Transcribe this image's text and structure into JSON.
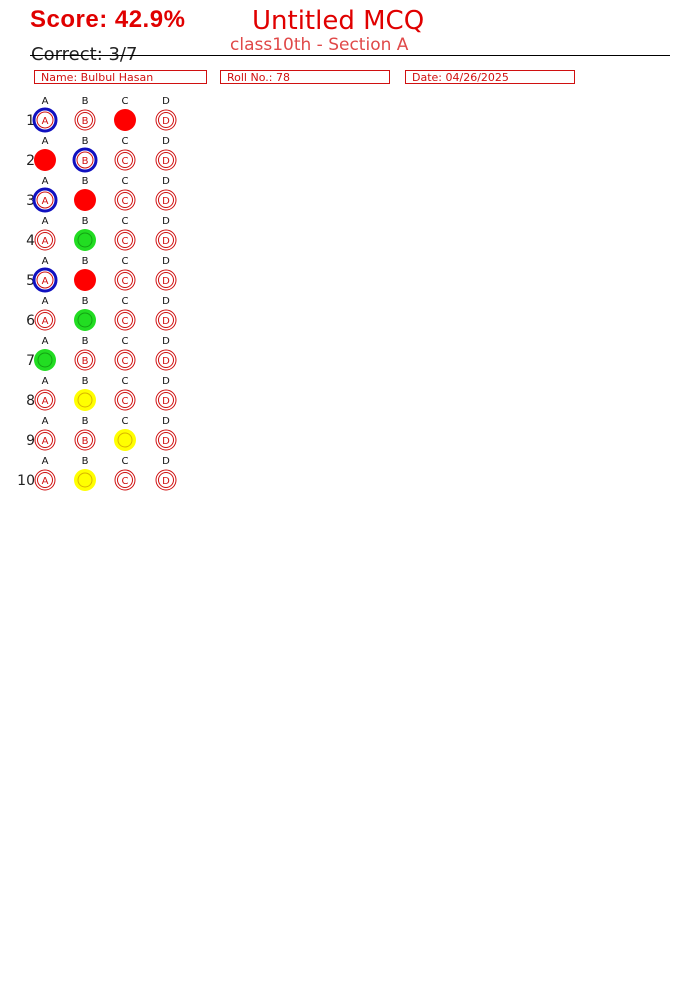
{
  "header": {
    "score": "Score: 42.9%",
    "title": "Untitled MCQ",
    "subtitle": "class10th - Section A",
    "correct": "Correct: 3/7"
  },
  "fields": {
    "name": "Name: Bulbul Hasan",
    "roll": "Roll No.: 78",
    "date": "Date: 04/26/2025"
  },
  "options": [
    "A",
    "B",
    "C",
    "D"
  ],
  "colors": {
    "outline": "#d01010",
    "wrong": "#ff0000",
    "correct": "#22dd22",
    "unanswered": "#ffff00",
    "key": "#1010c0"
  },
  "questions": [
    {
      "number": "1",
      "marks": {
        "A": "key",
        "C": "wrong"
      }
    },
    {
      "number": "2",
      "marks": {
        "A": "wrong",
        "B": "key"
      }
    },
    {
      "number": "3",
      "marks": {
        "A": "key",
        "B": "wrong"
      }
    },
    {
      "number": "4",
      "marks": {
        "B": "correct"
      }
    },
    {
      "number": "5",
      "marks": {
        "A": "key",
        "B": "wrong"
      }
    },
    {
      "number": "6",
      "marks": {
        "B": "correct"
      }
    },
    {
      "number": "7",
      "marks": {
        "A": "correct"
      }
    },
    {
      "number": "8",
      "marks": {
        "B": "unanswered"
      }
    },
    {
      "number": "9",
      "marks": {
        "C": "unanswered"
      }
    },
    {
      "number": "10",
      "marks": {
        "B": "unanswered"
      }
    }
  ]
}
